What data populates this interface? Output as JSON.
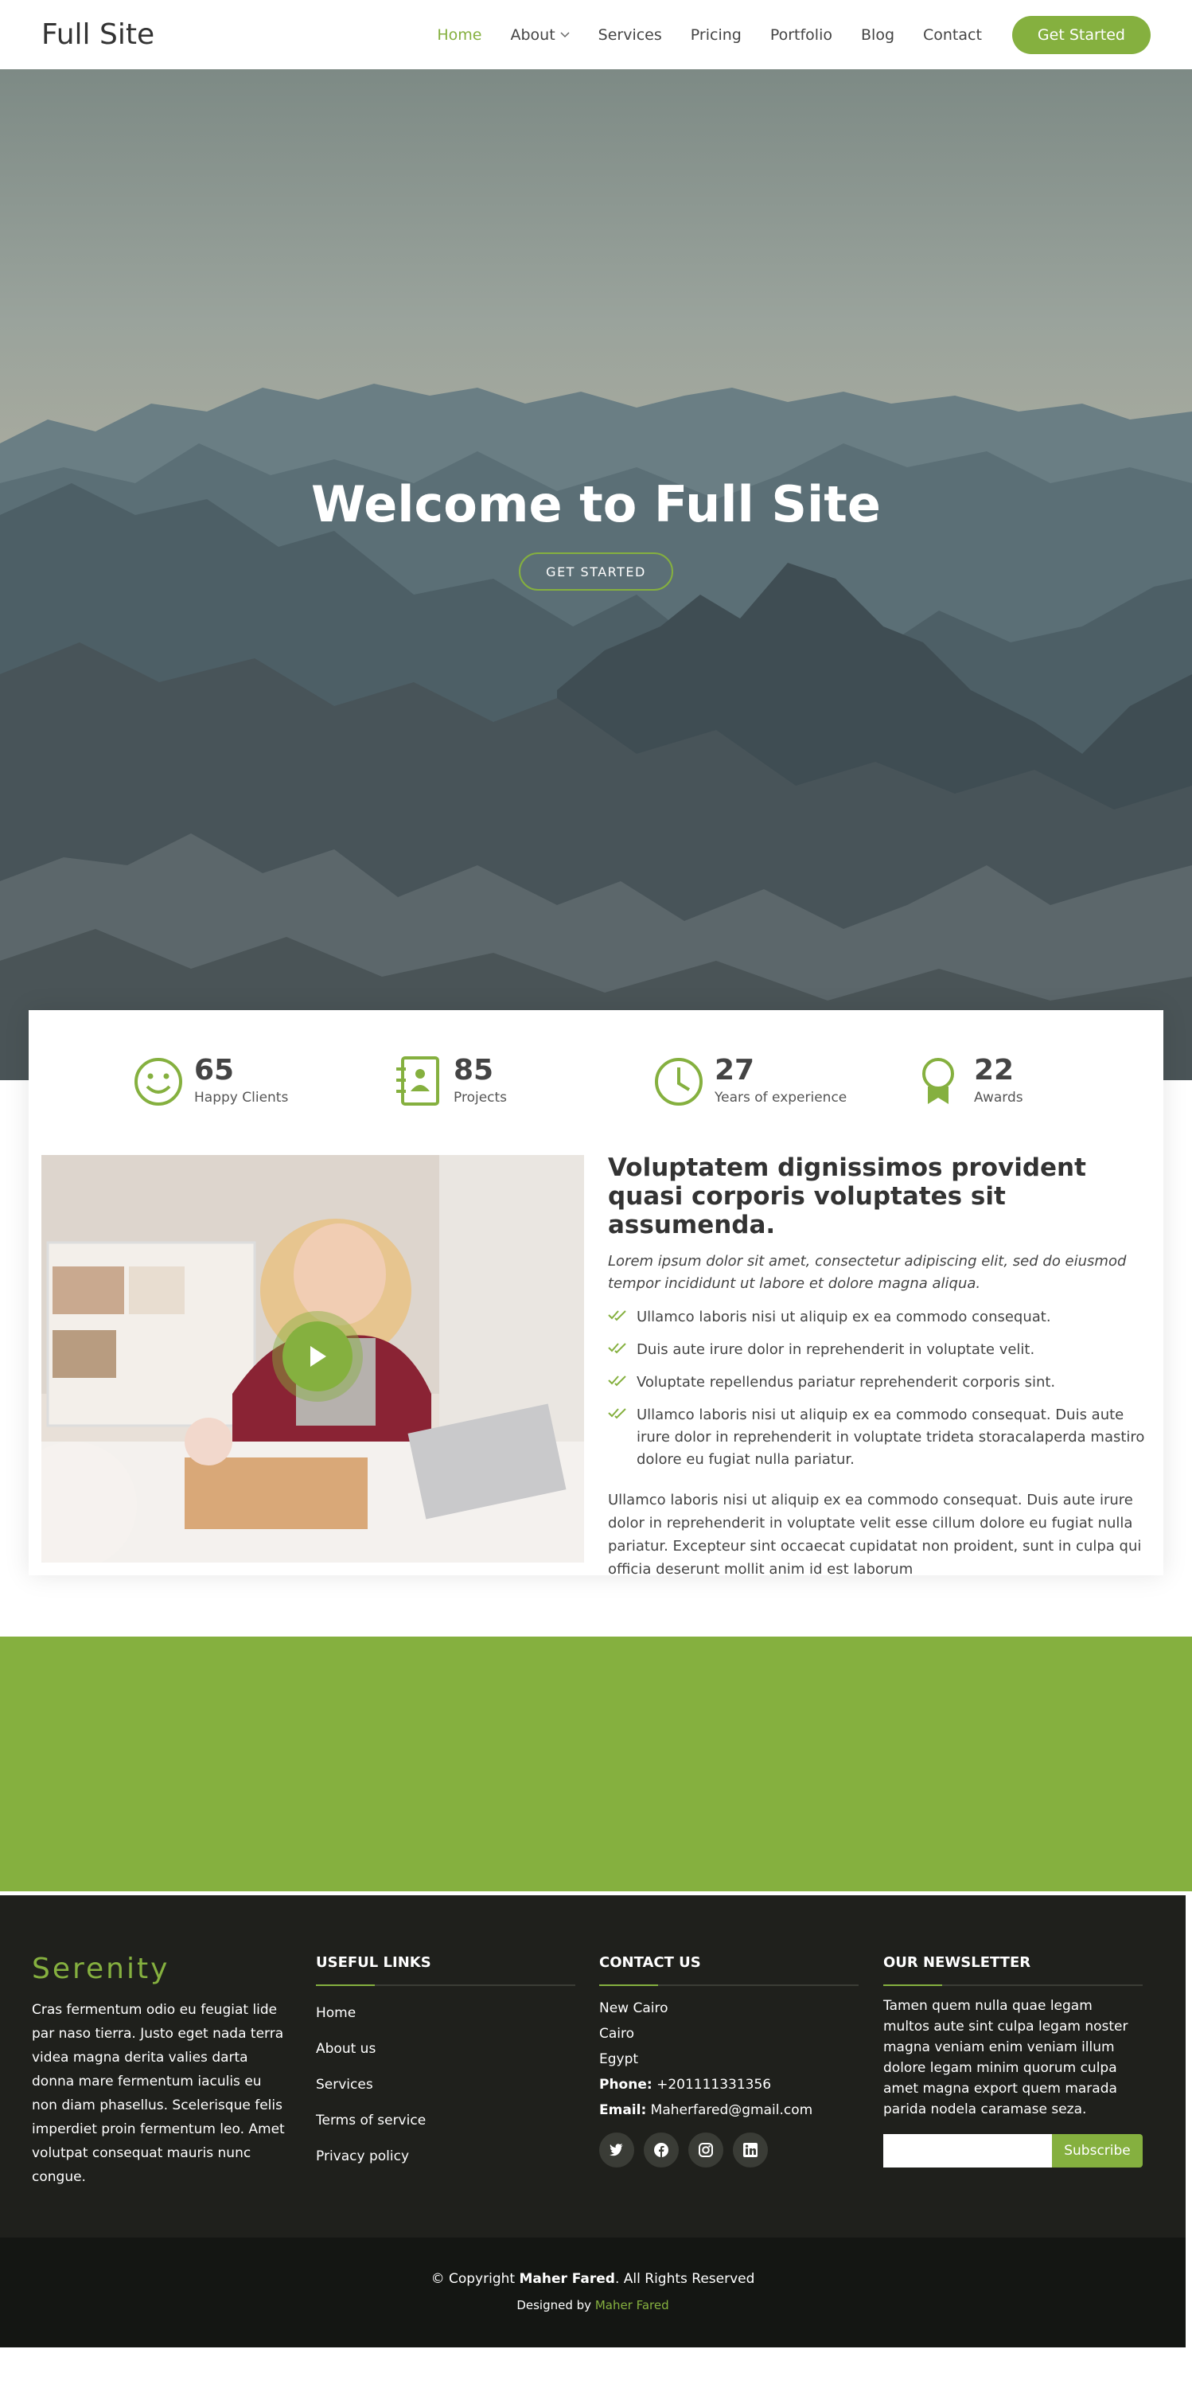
{
  "header": {
    "logo": "Full Site",
    "nav": [
      "Home",
      "About",
      "Services",
      "Pricing",
      "Portfolio",
      "Blog",
      "Contact"
    ],
    "active": "Home",
    "cta": "Get Started"
  },
  "hero": {
    "title": "Welcome to Full Site",
    "button": "GET STARTED"
  },
  "stats": [
    {
      "icon": "smile-icon",
      "value": "65",
      "label": "Happy Clients"
    },
    {
      "icon": "journal-icon",
      "value": "85",
      "label": "Projects"
    },
    {
      "icon": "clock-icon",
      "value": "27",
      "label": "Years of experience"
    },
    {
      "icon": "award-icon",
      "value": "22",
      "label": "Awards"
    }
  ],
  "about": {
    "title": "Voluptatem dignissimos provident quasi corporis voluptates sit assumenda.",
    "lead": "Lorem ipsum dolor sit amet, consectetur adipiscing elit, sed do eiusmod tempor incididunt ut labore et dolore magna aliqua.",
    "items": [
      "Ullamco laboris nisi ut aliquip ex ea commodo consequat.",
      "Duis aute irure dolor in reprehenderit in voluptate velit.",
      "Voluptate repellendus pariatur reprehenderit corporis sint.",
      "Ullamco laboris nisi ut aliquip ex ea commodo consequat. Duis aute irure dolor in reprehenderit in voluptate trideta storacalaperda mastiro dolore eu fugiat nulla pariatur."
    ],
    "paragraph": "Ullamco laboris nisi ut aliquip ex ea commodo consequat. Duis aute irure dolor in reprehenderit in voluptate velit esse cillum dolore eu fugiat nulla pariatur. Excepteur sint occaecat cupidatat non proident, sunt in culpa qui officia deserunt mollit anim id est laborum"
  },
  "footer": {
    "brand": "Serenity",
    "brand_text": "Cras fermentum odio eu feugiat lide par naso tierra. Justo eget nada terra videa magna derita valies darta donna mare fermentum iaculis eu non diam phasellus. Scelerisque felis imperdiet proin fermentum leo. Amet volutpat consequat mauris nunc congue.",
    "links_title": "USEFUL LINKS",
    "links": [
      "Home",
      "About us",
      "Services",
      "Terms of service",
      "Privacy policy"
    ],
    "contact_title": "CONTACT US",
    "address": [
      "New Cairo",
      "Cairo",
      "Egypt"
    ],
    "phone_label": "Phone:",
    "phone": "+201111331356",
    "email_label": "Email:",
    "email": "Maherfared@gmail.com",
    "socials": [
      "twitter-icon",
      "facebook-icon",
      "instagram-icon",
      "linkedin-icon"
    ],
    "news_title": "OUR NEWSLETTER",
    "news_text": "Tamen quem nulla quae legam multos aute sint culpa legam noster magna veniam enim veniam illum dolore legam minim quorum culpa amet magna export quem marada parida nodela caramase seza.",
    "subscribe": "Subscribe"
  },
  "copyright": {
    "prefix": "© Copyright ",
    "name": "Maher Fared",
    "suffix": ". All Rights Reserved",
    "designed_prefix": "Designed by ",
    "designer": "Maher Fared"
  },
  "colors": {
    "accent": "#85b03f",
    "footer": "#1f201c",
    "copyright_bg": "#141613"
  }
}
